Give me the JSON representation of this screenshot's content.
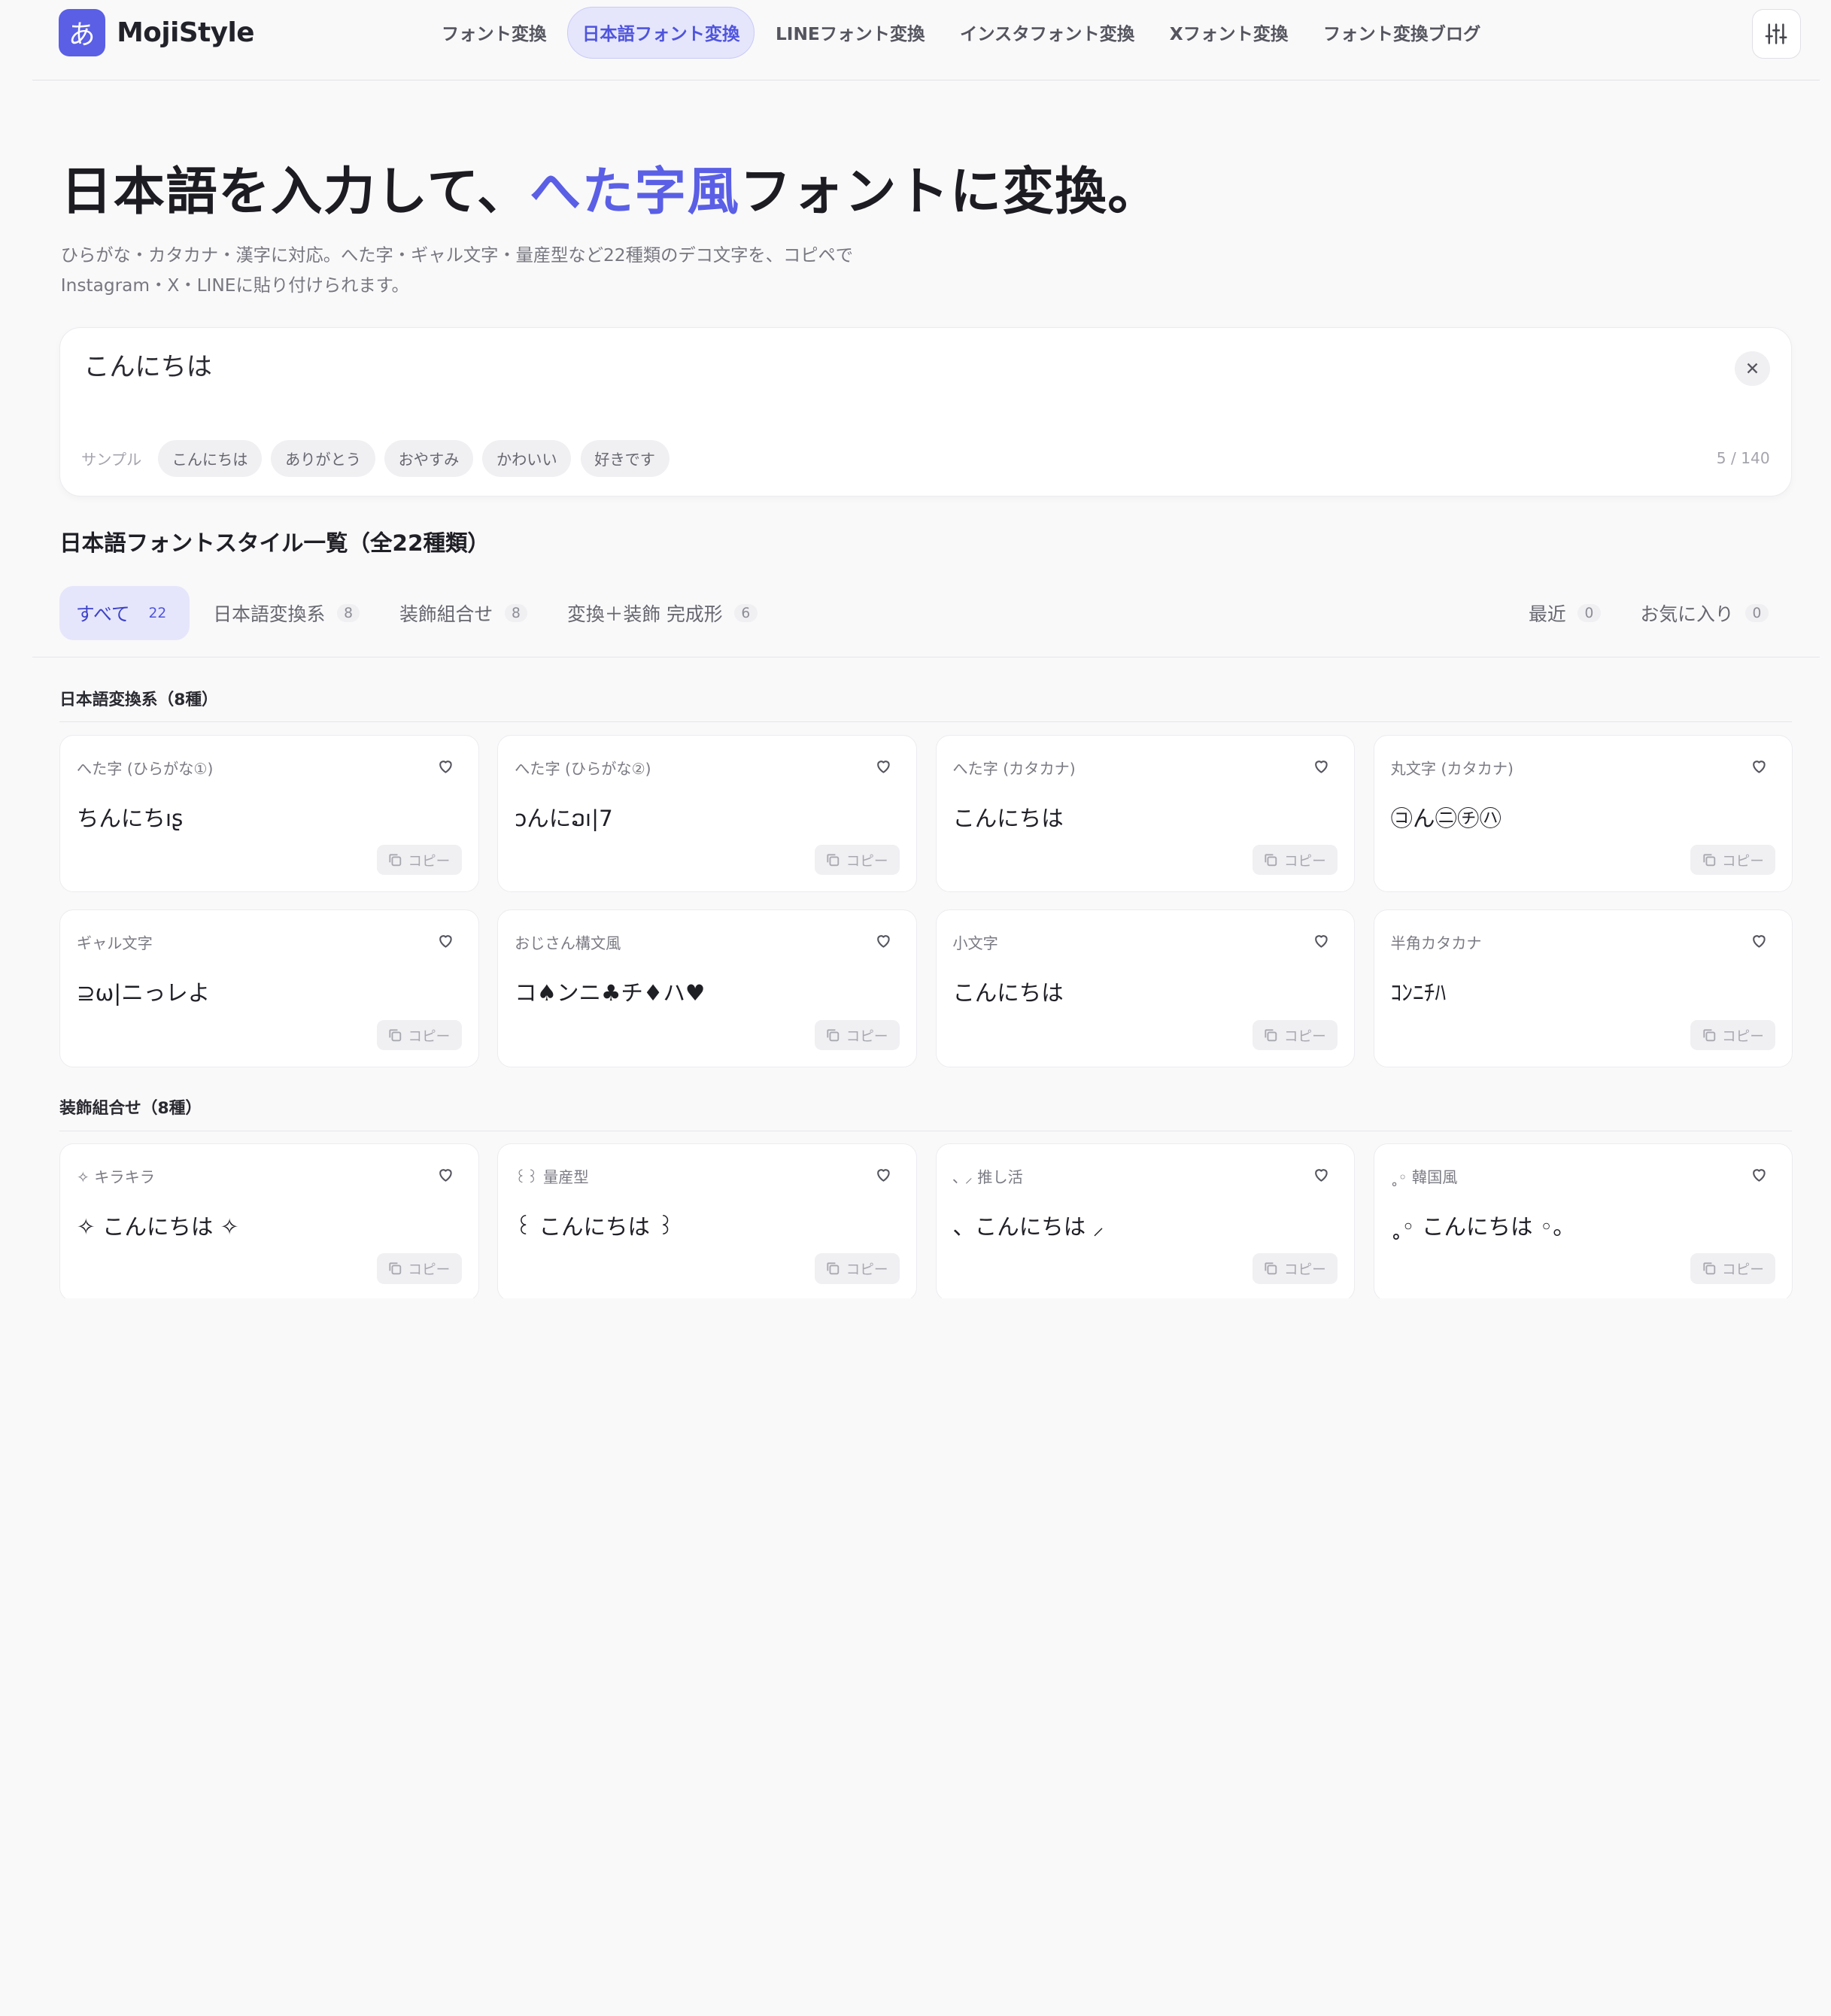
{
  "brand": {
    "logo_glyph": "あ",
    "name": "MojiStyle",
    "accent": "#5a5fe6"
  },
  "nav": [
    {
      "label": "フォント変換",
      "active": false
    },
    {
      "label": "日本語フォント変換",
      "active": true
    },
    {
      "label": "LINEフォント変換",
      "active": false
    },
    {
      "label": "インスタフォント変換",
      "active": false
    },
    {
      "label": "Xフォント変換",
      "active": false
    },
    {
      "label": "フォント変換ブログ",
      "active": false
    }
  ],
  "hero": {
    "title_before": "日本語を入力して、",
    "title_accent": "へた字風",
    "title_after": "フォントに変換。",
    "description": "ひらがな・カタカナ・漢字に対応。へた字・ギャル文字・量産型など22種類のデコ文字を、コピペでInstagram・X・LINEに貼り付けられます。"
  },
  "input": {
    "value": "こんにちは",
    "samples_label": "サンプル",
    "samples": [
      "こんにちは",
      "ありがとう",
      "おやすみ",
      "かわいい",
      "好きです"
    ],
    "counter": "5 / 140"
  },
  "list_title": "日本語フォントスタイル一覧（全22種類）",
  "tabs": [
    {
      "label": "すべて",
      "count": "22",
      "active": true
    },
    {
      "label": "日本語変換系",
      "count": "8",
      "active": false
    },
    {
      "label": "装飾組合せ",
      "count": "8",
      "active": false
    },
    {
      "label": "変換＋装飾 完成形",
      "count": "6",
      "active": false
    }
  ],
  "tabs_right": [
    {
      "label": "最近",
      "count": "0"
    },
    {
      "label": "お気に入り",
      "count": "0"
    }
  ],
  "copy_label": "コピー",
  "categories": [
    {
      "title": "日本語変換系（8種）",
      "cards": [
        {
          "name": "へた字 (ひらがな①)",
          "sample": "ちんにちıʂ"
        },
        {
          "name": "へた字 (ひらがな②)",
          "sample": "ɔんにວı|7"
        },
        {
          "name": "へた字 (カタカナ)",
          "sample": "こんにちは"
        },
        {
          "name": "丸文字 (カタカナ)",
          "sample": "㋙ん㊁㋠㋩"
        },
        {
          "name": "ギャル文字",
          "sample": "⊇ω|ニっレよ"
        },
        {
          "name": "おじさん構文風",
          "sample": "コ♠ンニ♣チ♦ハ♥"
        },
        {
          "name": "小文字",
          "sample": "こんにちは"
        },
        {
          "name": "半角カタカナ",
          "sample": "ｺﾝﾆﾁﾊ"
        }
      ]
    },
    {
      "title": "装飾組合せ（8種）",
      "cards": [
        {
          "name": "✧ キラキラ",
          "sample": "✧ こんにちは ✧"
        },
        {
          "name": "꒰꒱ 量産型",
          "sample": "꒰ こんにちは ꒱"
        },
        {
          "name": "､ ⸝ 推し活",
          "sample": "、こんにちは ⸝"
        },
        {
          "name": "˳◦ 韓国風",
          "sample": "˳◦ こんにちは ◦。"
        }
      ]
    }
  ]
}
